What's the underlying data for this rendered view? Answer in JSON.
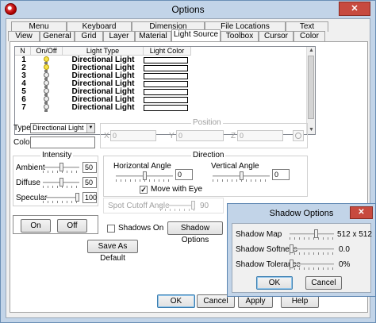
{
  "window": {
    "title": "Options",
    "close_label": "✕"
  },
  "tabs_top": [
    "Menu",
    "Keyboard",
    "Dimension",
    "File Locations",
    "Text"
  ],
  "tabs_bottom": [
    "View",
    "General",
    "Grid",
    "Layer",
    "Material",
    "Light Source",
    "Toolbox",
    "Cursor",
    "Color"
  ],
  "active_tab": "Light Source",
  "light_list": {
    "headers": [
      "N",
      "On/Off",
      "Light Type",
      "Light Color"
    ],
    "rows": [
      {
        "n": "1",
        "on": true,
        "type": "Directional Light"
      },
      {
        "n": "2",
        "on": true,
        "type": "Directional Light"
      },
      {
        "n": "3",
        "on": false,
        "type": "Directional Light"
      },
      {
        "n": "4",
        "on": false,
        "type": "Directional Light"
      },
      {
        "n": "5",
        "on": false,
        "type": "Directional Light"
      },
      {
        "n": "6",
        "on": false,
        "type": "Directional Light"
      },
      {
        "n": "7",
        "on": false,
        "type": "Directional Light"
      }
    ]
  },
  "type_label": "Type",
  "type_value": "Directional Light",
  "color_label": "Color",
  "position": {
    "title": "Position",
    "x_label": "X",
    "x_value": "0",
    "y_label": "Y",
    "y_value": "0",
    "z_label": "Z",
    "z_value": "0"
  },
  "intensity": {
    "title": "Intensity",
    "ambient_label": "Ambient",
    "ambient_value": "50",
    "ambient_level": 0.5,
    "diffuse_label": "Diffuse",
    "diffuse_value": "50",
    "diffuse_level": 0.5,
    "specular_label": "Specular",
    "specular_value": "100",
    "specular_level": 1.0
  },
  "direction": {
    "title": "Direction",
    "horizontal_label": "Horizontal Angle",
    "horizontal_value": "0",
    "horizontal_level": 0.5,
    "vertical_label": "Vertical Angle",
    "vertical_value": "0",
    "vertical_level": 0.5,
    "move_with_eye_label": "Move with Eye",
    "move_with_eye_checked": true
  },
  "spot_cutoff": {
    "label": "Spot Cutoff Angle",
    "value": "90",
    "level": 1.0
  },
  "onoff": {
    "on_label": "On",
    "off_label": "Off"
  },
  "shadows_on_label": "Shadows On",
  "shadow_options_label": "Shadow Options",
  "save_default_label": "Save As Default",
  "dialog_buttons": {
    "ok": "OK",
    "cancel": "Cancel",
    "apply": "Apply",
    "help": "Help"
  },
  "shadow_dialog": {
    "title": "Shadow Options",
    "close_label": "✕",
    "map_label": "Shadow Map",
    "map_value": "512 x 512",
    "map_level": 0.6,
    "softness_label": "Shadow Softness",
    "softness_value": "0.0",
    "softness_level": 0.0,
    "tolerance_label": "Shadow Tolerance",
    "tolerance_value": "0%",
    "tolerance_level": 0.0,
    "ok": "OK",
    "cancel": "Cancel"
  }
}
